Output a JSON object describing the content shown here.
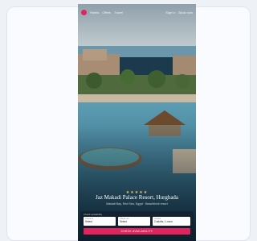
{
  "nav": {
    "links": [
      "Hotels",
      "Offers",
      "Travel",
      "Sign in",
      "Book now"
    ]
  },
  "hero": {
    "stars": "★★★★★",
    "title": "Jaz Makadi Palace Resort, Hurghada",
    "subtitle": "Makadi Bay, Red Sea, Egypt · Beachfront resort"
  },
  "booking": {
    "heading": "Check availability",
    "fields": [
      {
        "label": "Check-in",
        "value": "Select"
      },
      {
        "label": "Check-out",
        "value": "Select"
      },
      {
        "label": "Guests",
        "value": "2 adults, 1 room"
      }
    ],
    "cta": "CHECK AVAILABILITY"
  },
  "colors": {
    "accent": "#e0245e",
    "star": "#e7c46a"
  }
}
